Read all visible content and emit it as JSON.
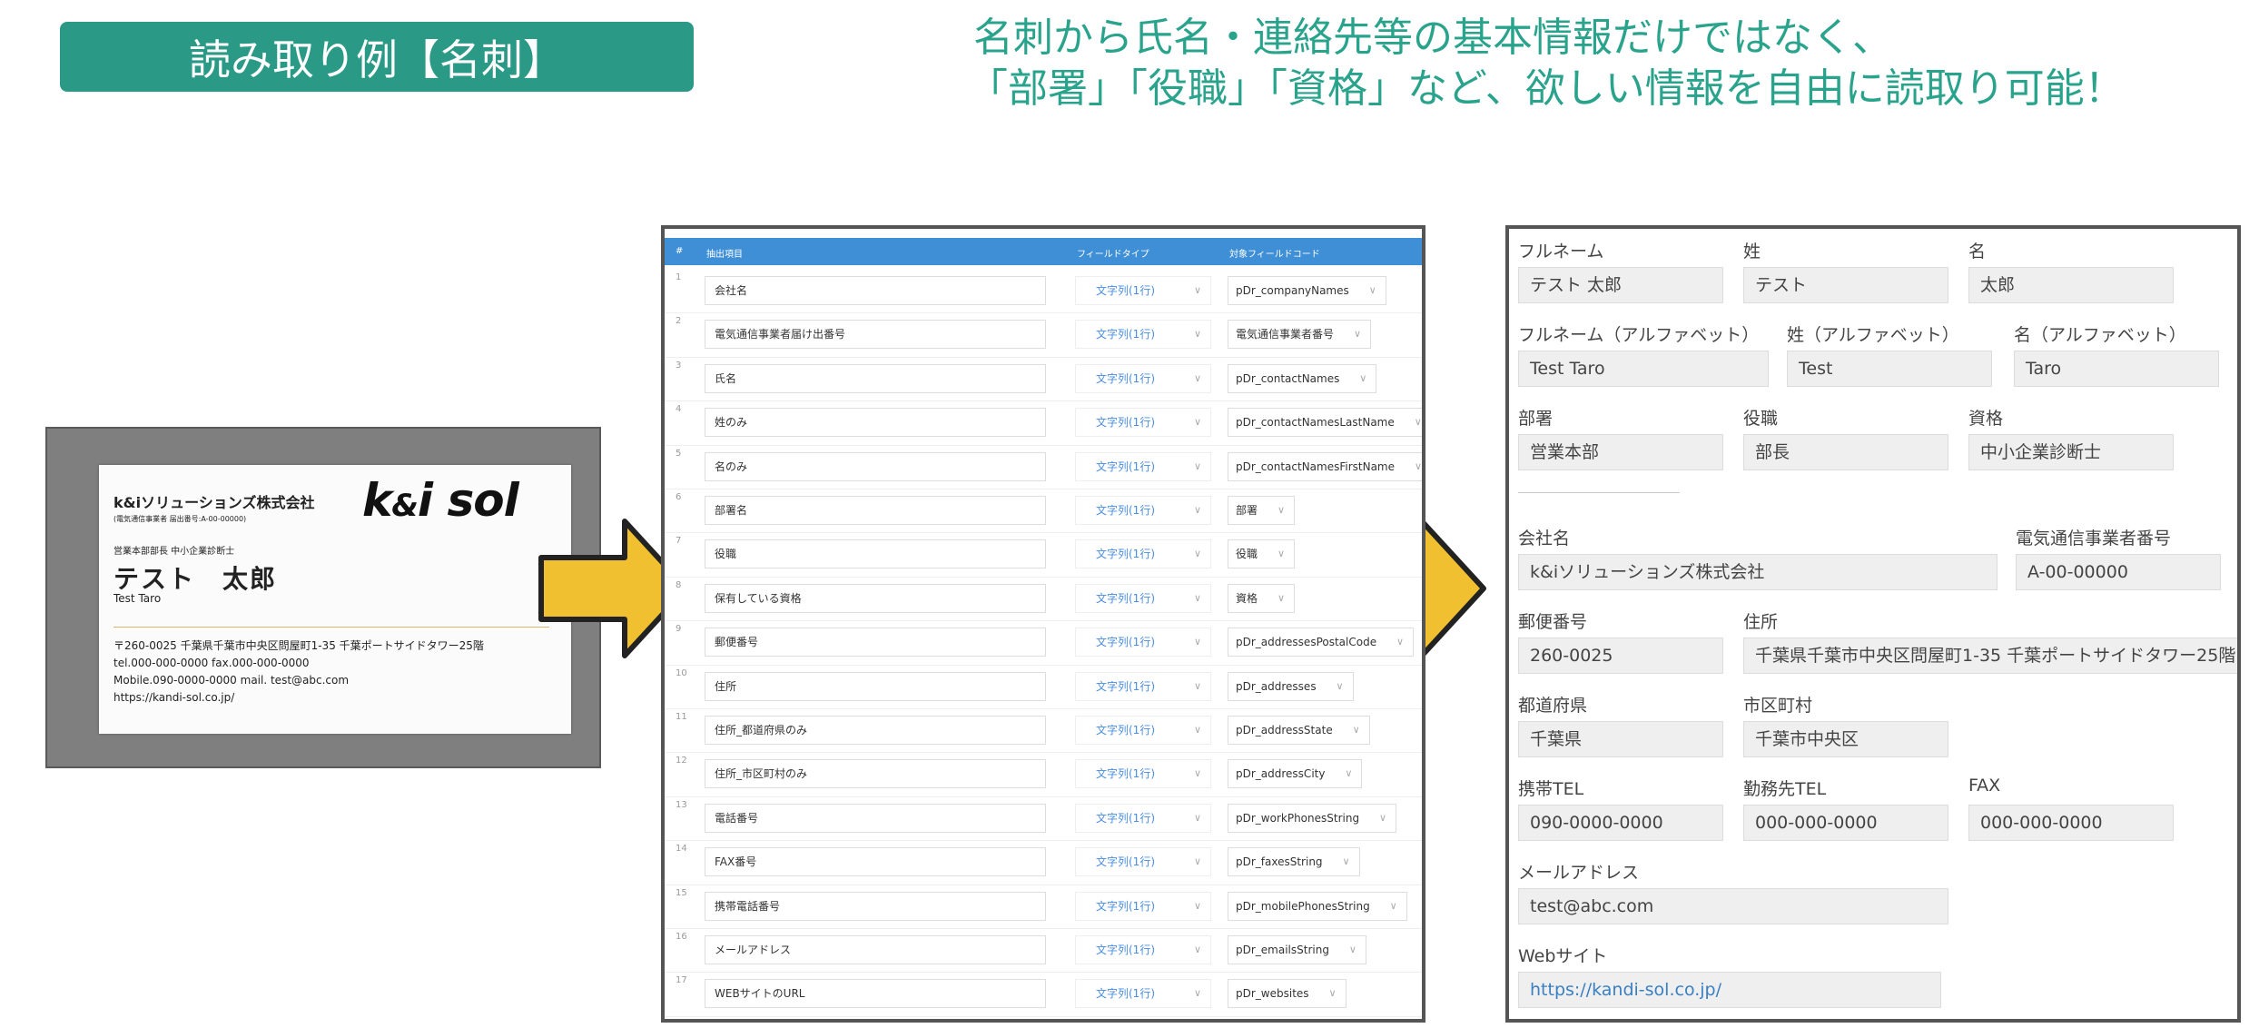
{
  "header": {
    "badge": "読み取り例【名刺】",
    "headline_line1": "名刺から氏名・連絡先等の基本情報だけではなく、",
    "headline_line2": "「部署」「役職」「資格」など、欲しい情報を自由に読取り可能！"
  },
  "card": {
    "company": "k&iソリューションズ株式会社",
    "registration": "(電気通信事業者 届出番号:A-00-00000)",
    "logo_text": "k&i sol",
    "title": "営業本部部長 中小企業診断士",
    "name": "テスト　太郎",
    "name_roman": "Test Taro",
    "address": "〒260-0025 千葉県千葉市中央区問屋町1-35 千葉ポートサイドタワー25階",
    "tel_fax": "tel.000-000-0000 fax.000-000-0000",
    "mobile_mail": "Mobile.090-0000-0000 mail. test@abc.com",
    "url": "https://kandi-sol.co.jp/"
  },
  "table": {
    "headers": {
      "num": "#",
      "item": "抽出項目",
      "type": "フィールドタイプ",
      "code": "対象フィールドコード"
    },
    "rows": [
      {
        "num": "1",
        "name": "会社名",
        "type": "文字列(1行)",
        "code": "pDr_companyNames"
      },
      {
        "num": "2",
        "name": "電気通信事業者届け出番号",
        "type": "文字列(1行)",
        "code": "電気通信事業者番号"
      },
      {
        "num": "3",
        "name": "氏名",
        "type": "文字列(1行)",
        "code": "pDr_contactNames"
      },
      {
        "num": "4",
        "name": "姓のみ",
        "type": "文字列(1行)",
        "code": "pDr_contactNamesLastName"
      },
      {
        "num": "5",
        "name": "名のみ",
        "type": "文字列(1行)",
        "code": "pDr_contactNamesFirstName"
      },
      {
        "num": "6",
        "name": "部署名",
        "type": "文字列(1行)",
        "code": "部署"
      },
      {
        "num": "7",
        "name": "役職",
        "type": "文字列(1行)",
        "code": "役職"
      },
      {
        "num": "8",
        "name": "保有している資格",
        "type": "文字列(1行)",
        "code": "資格"
      },
      {
        "num": "9",
        "name": "郵便番号",
        "type": "文字列(1行)",
        "code": "pDr_addressesPostalCode"
      },
      {
        "num": "10",
        "name": "住所",
        "type": "文字列(1行)",
        "code": "pDr_addresses"
      },
      {
        "num": "11",
        "name": "住所_都道府県のみ",
        "type": "文字列(1行)",
        "code": "pDr_addressState"
      },
      {
        "num": "12",
        "name": "住所_市区町村のみ",
        "type": "文字列(1行)",
        "code": "pDr_addressCity"
      },
      {
        "num": "13",
        "name": "電話番号",
        "type": "文字列(1行)",
        "code": "pDr_workPhonesString"
      },
      {
        "num": "14",
        "name": "FAX番号",
        "type": "文字列(1行)",
        "code": "pDr_faxesString"
      },
      {
        "num": "15",
        "name": "携帯電話番号",
        "type": "文字列(1行)",
        "code": "pDr_mobilePhonesString"
      },
      {
        "num": "16",
        "name": "メールアドレス",
        "type": "文字列(1行)",
        "code": "pDr_emailsString"
      },
      {
        "num": "17",
        "name": "WEBサイトのURL",
        "type": "文字列(1行)",
        "code": "pDr_websites"
      }
    ]
  },
  "form": {
    "fullname": {
      "label": "フルネーム",
      "value": "テスト 太郎"
    },
    "last": {
      "label": "姓",
      "value": "テスト"
    },
    "first": {
      "label": "名",
      "value": "太郎"
    },
    "fullname_en": {
      "label": "フルネーム（アルファベット）",
      "value": "Test Taro"
    },
    "last_en": {
      "label": "姓（アルファベット）",
      "value": "Test"
    },
    "first_en": {
      "label": "名（アルファベット）",
      "value": "Taro"
    },
    "dept": {
      "label": "部署",
      "value": "営業本部"
    },
    "position": {
      "label": "役職",
      "value": "部長"
    },
    "qualification": {
      "label": "資格",
      "value": "中小企業診断士"
    },
    "company": {
      "label": "会社名",
      "value": "k&iソリューションズ株式会社"
    },
    "telecom": {
      "label": "電気通信事業者番号",
      "value": "A-00-00000"
    },
    "postal": {
      "label": "郵便番号",
      "value": "260-0025"
    },
    "address": {
      "label": "住所",
      "value": "千葉県千葉市中央区問屋町1-35 千葉ポートサイドタワー25階"
    },
    "pref": {
      "label": "都道府県",
      "value": "千葉県"
    },
    "city": {
      "label": "市区町村",
      "value": "千葉市中央区"
    },
    "mobile": {
      "label": "携帯TEL",
      "value": "090-0000-0000"
    },
    "worktel": {
      "label": "勤務先TEL",
      "value": "000-000-0000"
    },
    "fax": {
      "label": "FAX",
      "value": "000-000-0000"
    },
    "email": {
      "label": "メールアドレス",
      "value": "test@abc.com"
    },
    "web": {
      "label": "Webサイト",
      "value": "https://kandi-sol.co.jp/"
    }
  },
  "colors": {
    "accent": "#2a9a86",
    "arrow": "#f0c030",
    "table_header": "#3f8fd6"
  }
}
